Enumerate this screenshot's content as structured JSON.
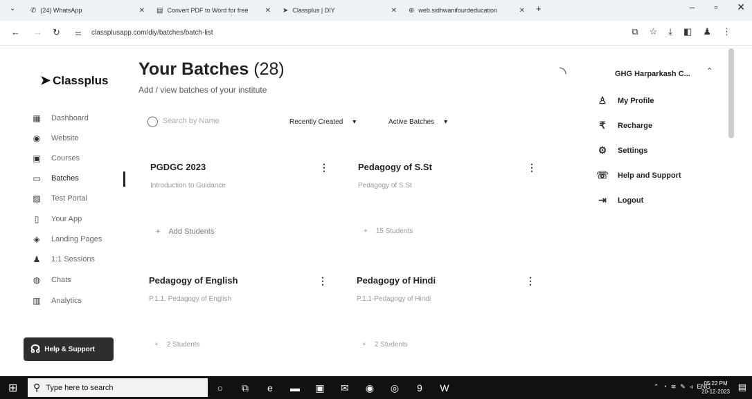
{
  "browser": {
    "tabs": [
      {
        "icon": "whatsapp-icon",
        "glyph": "✆",
        "label": "(24) WhatsApp"
      },
      {
        "icon": "pdf-converter-icon",
        "glyph": "▤",
        "label": "Convert PDF to Word for free"
      },
      {
        "icon": "classplus-icon",
        "glyph": "➤",
        "label": "Classplus | DIY"
      },
      {
        "icon": "globe-icon",
        "glyph": "⊕",
        "label": "web.sidhwanifourdeducation"
      }
    ],
    "url": "classplusapp.com/diy/batches/batch-list"
  },
  "sidebar": {
    "logo": "Classplus",
    "items": [
      {
        "label": "Dashboard",
        "icon": "dashboard-icon",
        "glyph": "▦"
      },
      {
        "label": "Website",
        "icon": "website-icon",
        "glyph": "◉"
      },
      {
        "label": "Courses",
        "icon": "courses-icon",
        "glyph": "▣"
      },
      {
        "label": "Batches",
        "icon": "batches-icon",
        "glyph": "▭"
      },
      {
        "label": "Test Portal",
        "icon": "test-portal-icon",
        "glyph": "▨"
      },
      {
        "label": "Your App",
        "icon": "your-app-icon",
        "glyph": "▯"
      },
      {
        "label": "Landing Pages",
        "icon": "landing-pages-icon",
        "glyph": "◈"
      },
      {
        "label": "1:1 Sessions",
        "icon": "sessions-icon",
        "glyph": "♟"
      },
      {
        "label": "Chats",
        "icon": "chats-icon",
        "glyph": "◍"
      },
      {
        "label": "Analytics",
        "icon": "analytics-icon",
        "glyph": "▥"
      }
    ],
    "help_label": "Help & Support"
  },
  "main": {
    "title": "Your Batches",
    "count": "(28)",
    "subtitle": "Add / view batches of your institute",
    "search_placeholder": "Search by Name",
    "sort_label": "Recently Created",
    "status_label": "Active Batches",
    "batches": [
      {
        "name": "PGDGC 2023",
        "description": "Introduction to Guidance",
        "students": "Add Students"
      },
      {
        "name": "Pedagogy of S.St",
        "description": "Pedagogy of S.St",
        "students": "15 Students"
      },
      {
        "name": "Pedagogy of English",
        "description": "P.1.1. Pedagogy of English",
        "students": "2 Students"
      },
      {
        "name": "Pedagogy of Hindi",
        "description": "P.1.1-Pedagogy of Hindi",
        "students": "2 Students"
      }
    ]
  },
  "profile_menu": {
    "user": "GHG Harparkash C...",
    "items": [
      {
        "label": "My Profile",
        "icon": "user-icon",
        "glyph": "♙"
      },
      {
        "label": "Recharge",
        "icon": "rupee-icon",
        "glyph": "₹"
      },
      {
        "label": "Settings",
        "icon": "settings-icon",
        "glyph": "⚙"
      },
      {
        "label": "Help and Support",
        "icon": "help-icon",
        "glyph": "☏"
      },
      {
        "label": "Logout",
        "icon": "logout-icon",
        "glyph": "⇥"
      }
    ]
  },
  "taskbar": {
    "search_placeholder": "Type here to search",
    "language": "ENG",
    "time": "05:22 PM",
    "date": "20-12-2023"
  }
}
